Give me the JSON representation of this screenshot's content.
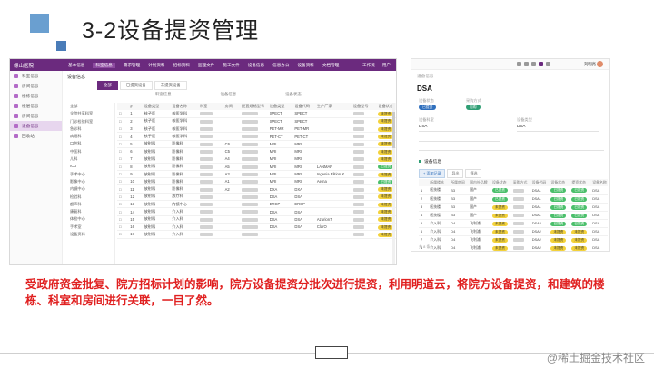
{
  "slide": {
    "title": "3-2设备提资管理",
    "caption": "受政府资金批复、院方招标计划的影响，院方设备提资分批次进行提资，利用明道云，将院方设备提资，和建筑的楼栋、科室和房间进行关联，一目了然。",
    "watermark": "@稀土掘金技术社区",
    "colors": {
      "accent_square": "#6a9fd0",
      "caption": "#e02020",
      "topbar": "#6b2a7e"
    }
  },
  "left_app": {
    "logo": "螺山医院",
    "nav": [
      "基本信息",
      "科室信息",
      "需求管理",
      "计划资料",
      "招标资料",
      "监理文件",
      "施工文件",
      "设备信息",
      "信息办公",
      "设备资料",
      "文档管理"
    ],
    "right_actions": [
      "工作流",
      "用户"
    ],
    "sidebar": [
      {
        "label": "科室信息",
        "active": false
      },
      {
        "label": "房间信息",
        "active": false
      },
      {
        "label": "楼栋信息",
        "active": false
      },
      {
        "label": "楼层信息",
        "active": false
      },
      {
        "label": "房间信息",
        "active": false
      },
      {
        "label": "设备信息",
        "active": true
      },
      {
        "label": "回收站",
        "active": false
      }
    ],
    "crumb": "设备信息",
    "tabs": [
      "全部",
      "已提资设备",
      "未提资设备"
    ],
    "filters": [
      "科室信息",
      "设备信息",
      "设备状态"
    ],
    "tree": [
      "全部",
      "全院共享科室",
      "门诊检验科室",
      "急诊科",
      "病理科",
      "口腔科",
      "中医科",
      "儿科",
      "ICU",
      "手术中心",
      "影像中心",
      "内镜中心",
      "检验科",
      "超声科",
      "康复科",
      "体检中心",
      "手术室",
      "设备资料"
    ],
    "columns": [
      "",
      "#",
      "设备类型",
      "设备名称",
      "科室",
      "房间",
      "配置规格型号",
      "设备类型",
      "设备代码",
      "生产厂家",
      "设备型号",
      "设备状态"
    ],
    "rows": [
      {
        "n": "1",
        "type": "核子医",
        "name": "核医学科",
        "room": "",
        "model": "SPECT",
        "code": "SPECT",
        "vendor": "",
        "st": "y"
      },
      {
        "n": "2",
        "type": "核子医",
        "name": "核医学科",
        "room": "",
        "model": "SPECT",
        "code": "SPECT",
        "vendor": "",
        "st": "y"
      },
      {
        "n": "3",
        "type": "核子医",
        "name": "核医学科",
        "room": "",
        "model": "PET-MR",
        "code": "PET-MR",
        "vendor": "",
        "st": "y"
      },
      {
        "n": "4",
        "type": "核子医",
        "name": "核医学科",
        "room": "",
        "model": "PET-CT",
        "code": "PET CT",
        "vendor": "",
        "st": "y"
      },
      {
        "n": "5",
        "type": "放射科",
        "name": "影像科",
        "room": "C6",
        "model": "MRI",
        "code": "MRI",
        "vendor": "",
        "st": "y"
      },
      {
        "n": "6",
        "type": "放射科",
        "name": "影像科",
        "room": "C5",
        "model": "MRI",
        "code": "MRI",
        "vendor": "",
        "st": "y"
      },
      {
        "n": "7",
        "type": "放射科",
        "name": "影像科",
        "room": "A4",
        "model": "MRI",
        "code": "MRI",
        "vendor": "",
        "st": "y"
      },
      {
        "n": "8",
        "type": "放射科",
        "name": "影像科",
        "room": "A5",
        "model": "MRI",
        "code": "MRI",
        "vendor": "LANMAR",
        "st": "g"
      },
      {
        "n": "9",
        "type": "放射科",
        "name": "影像科",
        "room": "A3",
        "model": "MRI",
        "code": "MRI",
        "vendor": "Ingenia Elition X",
        "st": "y"
      },
      {
        "n": "10",
        "type": "放射科",
        "name": "影像科",
        "room": "A1",
        "model": "MRI",
        "code": "MRI",
        "vendor": "Aetna",
        "st": "g"
      },
      {
        "n": "11",
        "type": "放射科",
        "name": "影像科",
        "room": "A2",
        "model": "DXA",
        "code": "DXA",
        "vendor": "",
        "st": "y"
      },
      {
        "n": "12",
        "type": "放射科",
        "name": "放疗科",
        "room": "",
        "model": "DSA",
        "code": "DSA",
        "vendor": "",
        "st": "y"
      },
      {
        "n": "13",
        "type": "放射科",
        "name": "内镜中心",
        "room": "",
        "model": "ERCP",
        "code": "ERCP",
        "vendor": "",
        "st": "y"
      },
      {
        "n": "14",
        "type": "放射科",
        "name": "介入科",
        "room": "",
        "model": "DSA",
        "code": "DSA",
        "vendor": "",
        "st": "y"
      },
      {
        "n": "15",
        "type": "放射科",
        "name": "介入科",
        "room": "",
        "model": "DSA",
        "code": "DSA",
        "vendor": "Azurion7",
        "st": "y"
      },
      {
        "n": "16",
        "type": "放射科",
        "name": "介入科",
        "room": "",
        "model": "DSA",
        "code": "DSA",
        "vendor": "ClarO",
        "st": "y"
      },
      {
        "n": "17",
        "type": "放射科",
        "name": "介入科",
        "room": "",
        "model": "",
        "code": "",
        "vendor": "",
        "st": "y"
      }
    ],
    "badge_texts": {
      "y": "未提资",
      "g": "已提资"
    }
  },
  "right_app": {
    "subtitle": "设备信息",
    "title": "DSA",
    "labels": {
      "status": "设备状态",
      "level": "采购方式",
      "dept": "设备科室",
      "type": "设备类型",
      "tools_section": "设备信息"
    },
    "badges": {
      "status": "已提资",
      "level": "自购"
    },
    "values": {
      "dept": "DSA",
      "type": "DSA"
    },
    "tools": [
      "+ 添加记录",
      "导出",
      "筛选"
    ],
    "columns": [
      "",
      "所属楼栋",
      "所属房间",
      "国内外品牌",
      "设备状态",
      "采购方式",
      "设备代码",
      "设备状态",
      "提资状态",
      "设备名称"
    ],
    "rows": [
      {
        "n": "1",
        "b": "医技楼",
        "r": "B3",
        "brand": "国产",
        "s1": "g",
        "code": "DSA1",
        "s2": "g",
        "s3": "g",
        "name": "DSA"
      },
      {
        "n": "2",
        "b": "医技楼",
        "r": "B3",
        "brand": "国产",
        "s1": "g",
        "code": "DSA1",
        "s2": "g",
        "s3": "g",
        "name": "DSA"
      },
      {
        "n": "3",
        "b": "医技楼",
        "r": "B3",
        "brand": "国产",
        "s1": "y",
        "code": "DSA1",
        "s2": "g",
        "s3": "g",
        "name": "DSA"
      },
      {
        "n": "4",
        "b": "医技楼",
        "r": "B3",
        "brand": "国产",
        "s1": "y",
        "code": "DSA1",
        "s2": "g",
        "s3": "g",
        "name": "DSA"
      },
      {
        "n": "5",
        "b": "介入科",
        "r": "D4",
        "brand": "飞利浦",
        "s1": "y",
        "code": "DSA3",
        "s2": "g",
        "s3": "g",
        "name": "DSA"
      },
      {
        "n": "6",
        "b": "介入科",
        "r": "D4",
        "brand": "飞利浦",
        "s1": "y",
        "code": "DSA2",
        "s2": "y",
        "s3": "y",
        "name": "DSA"
      },
      {
        "n": "7",
        "b": "介入科",
        "r": "D4",
        "brand": "飞利浦",
        "s1": "y",
        "code": "DSA2",
        "s2": "y",
        "s3": "y",
        "name": "DSA"
      },
      {
        "n": "8",
        "b": "介入科",
        "r": "D4",
        "brand": "飞利浦",
        "s1": "y",
        "code": "DSA2",
        "s2": "y",
        "s3": "y",
        "name": "DSA"
      }
    ],
    "footer": "共 8 条",
    "footer_right": "",
    "user": "刘明亮",
    "badge_texts": {
      "y": "未提资",
      "g": "已提资"
    }
  }
}
